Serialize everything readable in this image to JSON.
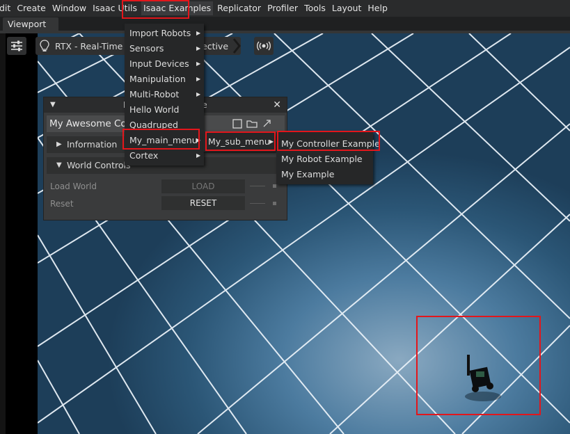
{
  "menubar": {
    "items": [
      "dit",
      "Create",
      "Window",
      "Isaac Utils",
      "Isaac Examples",
      "Replicator",
      "Profiler",
      "Tools",
      "Layout",
      "Help"
    ]
  },
  "tabs": {
    "viewport": "Viewport"
  },
  "viewport_toolbar": {
    "settings_icon": "sliders-icon",
    "renderer": "RTX - Real-Time",
    "camera": "ective",
    "camera_icon": "broadcast-icon"
  },
  "extension_window": {
    "title_partial": "M",
    "title_suffix": "e",
    "header": "My Awesome Co",
    "frames": {
      "information": "Information",
      "world_controls": "World Controls"
    },
    "rows": {
      "load_label": "Load World",
      "load_button": "LOAD",
      "reset_label": "Reset",
      "reset_button": "RESET"
    }
  },
  "isaac_examples_menu": {
    "items": [
      "Import Robots",
      "Sensors",
      "Input Devices",
      "Manipulation",
      "Multi-Robot",
      "Hello World",
      "Quadruped",
      "My_main_menu",
      "Cortex"
    ]
  },
  "sub_menu": {
    "items": [
      "My_sub_menu"
    ]
  },
  "leaf_menu": {
    "items": [
      "My Controller Example",
      "My Robot Example",
      "My Example"
    ]
  },
  "colors": {
    "highlight": "#e3161b",
    "menubar": "#2a2b2c",
    "floor": "#2b5676"
  }
}
